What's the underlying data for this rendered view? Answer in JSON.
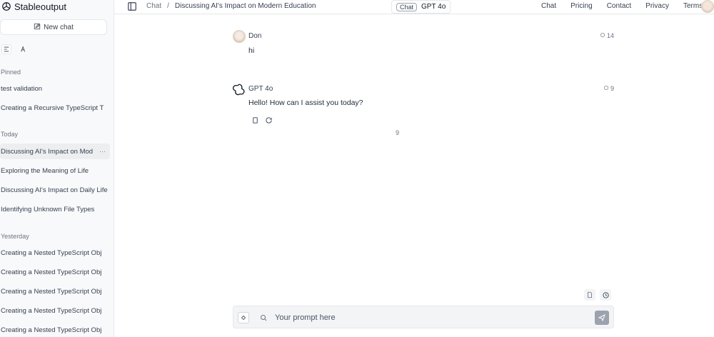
{
  "app": {
    "brand": "Stableoutput"
  },
  "sidebar": {
    "new_chat_label": "New chat",
    "sections": [
      {
        "label": "Pinned",
        "items": [
          "test validation",
          "Creating a Recursive TypeScript T"
        ]
      },
      {
        "label": "Today",
        "items": [
          "Discussing AI's Impact on Mod",
          "Exploring the Meaning of Life",
          "Discussing AI's Impact on Daily Life",
          "Identifying Unknown File Types"
        ]
      },
      {
        "label": "Yesterday",
        "items": [
          "Creating a Nested TypeScript Obj",
          "Creating a Nested TypeScript Obj",
          "Creating a Nested TypeScript Obj",
          "Creating a Nested TypeScript Obj",
          "Creating a Nested TypeScript Obj"
        ]
      }
    ],
    "more_label": "···"
  },
  "header": {
    "crumb_root": "Chat",
    "crumb_sep": "/",
    "crumb_current": "Discussing AI's Impact on Modern Education",
    "mode_label": "Chat",
    "model_label": "GPT 4o",
    "nav": [
      "Chat",
      "Pricing",
      "Contact",
      "Privacy",
      "Terms"
    ]
  },
  "messages": [
    {
      "author": "Don",
      "meta": "14",
      "text": "hi"
    },
    {
      "author": "GPT 4o",
      "meta": "9",
      "text": "Hello! How can I assist you today?"
    }
  ],
  "stray_char": "9",
  "composer": {
    "placeholder": "Your prompt here"
  }
}
